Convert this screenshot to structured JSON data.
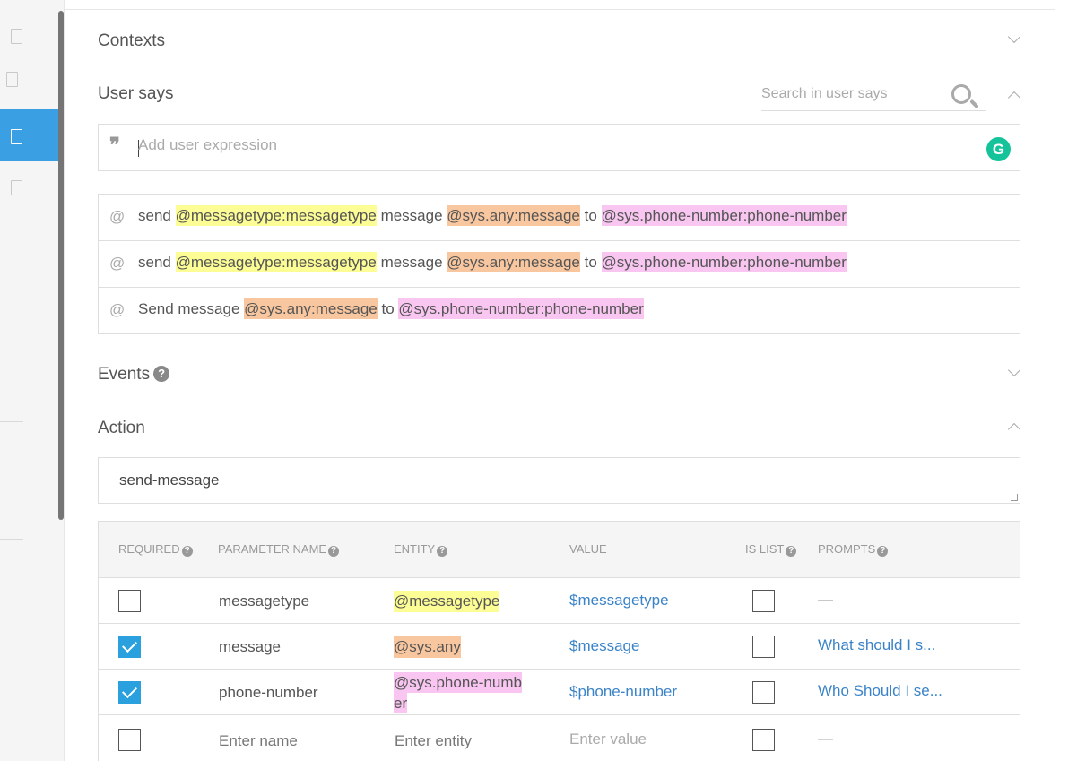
{
  "sections": {
    "contexts": "Contexts",
    "user_says": "User says",
    "events": "Events",
    "action": "Action"
  },
  "search": {
    "placeholder": "Search in user says"
  },
  "expression_input": {
    "placeholder": "Add user expression"
  },
  "phrases": [
    {
      "tokens": [
        {
          "text": "send",
          "hl": ""
        },
        {
          "text": "@messagetype:messagetype",
          "hl": "y"
        },
        {
          "text": "message",
          "hl": ""
        },
        {
          "text": "@sys.any:message",
          "hl": "o"
        },
        {
          "text": "to",
          "hl": ""
        },
        {
          "text": "@sys.phone-number:phone-number",
          "hl": "p"
        }
      ]
    },
    {
      "tokens": [
        {
          "text": "send",
          "hl": ""
        },
        {
          "text": "@messagetype:messagetype",
          "hl": "y"
        },
        {
          "text": "message",
          "hl": ""
        },
        {
          "text": "@sys.any:message",
          "hl": "o"
        },
        {
          "text": "to",
          "hl": ""
        },
        {
          "text": "@sys.phone-number:phone-number",
          "hl": "p"
        }
      ]
    },
    {
      "tokens": [
        {
          "text": "Send message",
          "hl": ""
        },
        {
          "text": "@sys.any:message",
          "hl": "o"
        },
        {
          "text": "to",
          "hl": ""
        },
        {
          "text": "@sys.phone-number:phone-number",
          "hl": "p"
        }
      ]
    }
  ],
  "action": {
    "value": "send-message"
  },
  "parameters": {
    "headers": {
      "required": "REQUIRED",
      "name": "PARAMETER NAME",
      "entity": "ENTITY",
      "value": "VALUE",
      "is_list": "IS LIST",
      "prompts": "PROMPTS"
    },
    "rows": [
      {
        "required": false,
        "name": "messagetype",
        "entity": "@messagetype",
        "entity_hl": "y",
        "value": "$messagetype",
        "is_list": false,
        "prompts": "—"
      },
      {
        "required": true,
        "name": "message",
        "entity": "@sys.any",
        "entity_hl": "o",
        "value": "$message",
        "is_list": false,
        "prompts": "What should I s..."
      },
      {
        "required": true,
        "name": "phone-number",
        "entity_line1": "@sys.phone-numb",
        "entity_line2": "er",
        "entity_hl": "p",
        "value": "$phone-number",
        "is_list": false,
        "prompts": "Who Should I se..."
      }
    ],
    "new_row": {
      "name_placeholder": "Enter name",
      "entity_placeholder": "Enter entity",
      "value_placeholder": "Enter value",
      "prompts": "—"
    }
  },
  "colors": {
    "accent": "#3aa0e3",
    "yellow_highlight": "#fdfd96",
    "orange_highlight": "#f9c79f",
    "pink_highlight": "#f8c6f0",
    "link": "#3a83c8"
  }
}
